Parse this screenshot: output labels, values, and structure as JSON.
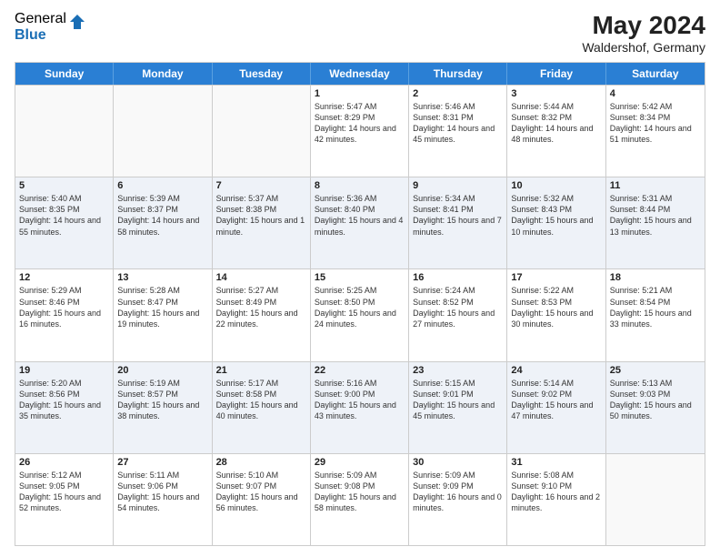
{
  "header": {
    "logo_general": "General",
    "logo_blue": "Blue",
    "main_title": "May 2024",
    "subtitle": "Waldershof, Germany"
  },
  "days": [
    "Sunday",
    "Monday",
    "Tuesday",
    "Wednesday",
    "Thursday",
    "Friday",
    "Saturday"
  ],
  "weeks": [
    [
      {
        "date": "",
        "sunrise": "",
        "sunset": "",
        "daylight": ""
      },
      {
        "date": "",
        "sunrise": "",
        "sunset": "",
        "daylight": ""
      },
      {
        "date": "",
        "sunrise": "",
        "sunset": "",
        "daylight": ""
      },
      {
        "date": "1",
        "sunrise": "Sunrise: 5:47 AM",
        "sunset": "Sunset: 8:29 PM",
        "daylight": "Daylight: 14 hours and 42 minutes."
      },
      {
        "date": "2",
        "sunrise": "Sunrise: 5:46 AM",
        "sunset": "Sunset: 8:31 PM",
        "daylight": "Daylight: 14 hours and 45 minutes."
      },
      {
        "date": "3",
        "sunrise": "Sunrise: 5:44 AM",
        "sunset": "Sunset: 8:32 PM",
        "daylight": "Daylight: 14 hours and 48 minutes."
      },
      {
        "date": "4",
        "sunrise": "Sunrise: 5:42 AM",
        "sunset": "Sunset: 8:34 PM",
        "daylight": "Daylight: 14 hours and 51 minutes."
      }
    ],
    [
      {
        "date": "5",
        "sunrise": "Sunrise: 5:40 AM",
        "sunset": "Sunset: 8:35 PM",
        "daylight": "Daylight: 14 hours and 55 minutes."
      },
      {
        "date": "6",
        "sunrise": "Sunrise: 5:39 AM",
        "sunset": "Sunset: 8:37 PM",
        "daylight": "Daylight: 14 hours and 58 minutes."
      },
      {
        "date": "7",
        "sunrise": "Sunrise: 5:37 AM",
        "sunset": "Sunset: 8:38 PM",
        "daylight": "Daylight: 15 hours and 1 minute."
      },
      {
        "date": "8",
        "sunrise": "Sunrise: 5:36 AM",
        "sunset": "Sunset: 8:40 PM",
        "daylight": "Daylight: 15 hours and 4 minutes."
      },
      {
        "date": "9",
        "sunrise": "Sunrise: 5:34 AM",
        "sunset": "Sunset: 8:41 PM",
        "daylight": "Daylight: 15 hours and 7 minutes."
      },
      {
        "date": "10",
        "sunrise": "Sunrise: 5:32 AM",
        "sunset": "Sunset: 8:43 PM",
        "daylight": "Daylight: 15 hours and 10 minutes."
      },
      {
        "date": "11",
        "sunrise": "Sunrise: 5:31 AM",
        "sunset": "Sunset: 8:44 PM",
        "daylight": "Daylight: 15 hours and 13 minutes."
      }
    ],
    [
      {
        "date": "12",
        "sunrise": "Sunrise: 5:29 AM",
        "sunset": "Sunset: 8:46 PM",
        "daylight": "Daylight: 15 hours and 16 minutes."
      },
      {
        "date": "13",
        "sunrise": "Sunrise: 5:28 AM",
        "sunset": "Sunset: 8:47 PM",
        "daylight": "Daylight: 15 hours and 19 minutes."
      },
      {
        "date": "14",
        "sunrise": "Sunrise: 5:27 AM",
        "sunset": "Sunset: 8:49 PM",
        "daylight": "Daylight: 15 hours and 22 minutes."
      },
      {
        "date": "15",
        "sunrise": "Sunrise: 5:25 AM",
        "sunset": "Sunset: 8:50 PM",
        "daylight": "Daylight: 15 hours and 24 minutes."
      },
      {
        "date": "16",
        "sunrise": "Sunrise: 5:24 AM",
        "sunset": "Sunset: 8:52 PM",
        "daylight": "Daylight: 15 hours and 27 minutes."
      },
      {
        "date": "17",
        "sunrise": "Sunrise: 5:22 AM",
        "sunset": "Sunset: 8:53 PM",
        "daylight": "Daylight: 15 hours and 30 minutes."
      },
      {
        "date": "18",
        "sunrise": "Sunrise: 5:21 AM",
        "sunset": "Sunset: 8:54 PM",
        "daylight": "Daylight: 15 hours and 33 minutes."
      }
    ],
    [
      {
        "date": "19",
        "sunrise": "Sunrise: 5:20 AM",
        "sunset": "Sunset: 8:56 PM",
        "daylight": "Daylight: 15 hours and 35 minutes."
      },
      {
        "date": "20",
        "sunrise": "Sunrise: 5:19 AM",
        "sunset": "Sunset: 8:57 PM",
        "daylight": "Daylight: 15 hours and 38 minutes."
      },
      {
        "date": "21",
        "sunrise": "Sunrise: 5:17 AM",
        "sunset": "Sunset: 8:58 PM",
        "daylight": "Daylight: 15 hours and 40 minutes."
      },
      {
        "date": "22",
        "sunrise": "Sunrise: 5:16 AM",
        "sunset": "Sunset: 9:00 PM",
        "daylight": "Daylight: 15 hours and 43 minutes."
      },
      {
        "date": "23",
        "sunrise": "Sunrise: 5:15 AM",
        "sunset": "Sunset: 9:01 PM",
        "daylight": "Daylight: 15 hours and 45 minutes."
      },
      {
        "date": "24",
        "sunrise": "Sunrise: 5:14 AM",
        "sunset": "Sunset: 9:02 PM",
        "daylight": "Daylight: 15 hours and 47 minutes."
      },
      {
        "date": "25",
        "sunrise": "Sunrise: 5:13 AM",
        "sunset": "Sunset: 9:03 PM",
        "daylight": "Daylight: 15 hours and 50 minutes."
      }
    ],
    [
      {
        "date": "26",
        "sunrise": "Sunrise: 5:12 AM",
        "sunset": "Sunset: 9:05 PM",
        "daylight": "Daylight: 15 hours and 52 minutes."
      },
      {
        "date": "27",
        "sunrise": "Sunrise: 5:11 AM",
        "sunset": "Sunset: 9:06 PM",
        "daylight": "Daylight: 15 hours and 54 minutes."
      },
      {
        "date": "28",
        "sunrise": "Sunrise: 5:10 AM",
        "sunset": "Sunset: 9:07 PM",
        "daylight": "Daylight: 15 hours and 56 minutes."
      },
      {
        "date": "29",
        "sunrise": "Sunrise: 5:09 AM",
        "sunset": "Sunset: 9:08 PM",
        "daylight": "Daylight: 15 hours and 58 minutes."
      },
      {
        "date": "30",
        "sunrise": "Sunrise: 5:09 AM",
        "sunset": "Sunset: 9:09 PM",
        "daylight": "Daylight: 16 hours and 0 minutes."
      },
      {
        "date": "31",
        "sunrise": "Sunrise: 5:08 AM",
        "sunset": "Sunset: 9:10 PM",
        "daylight": "Daylight: 16 hours and 2 minutes."
      },
      {
        "date": "",
        "sunrise": "",
        "sunset": "",
        "daylight": ""
      }
    ]
  ]
}
